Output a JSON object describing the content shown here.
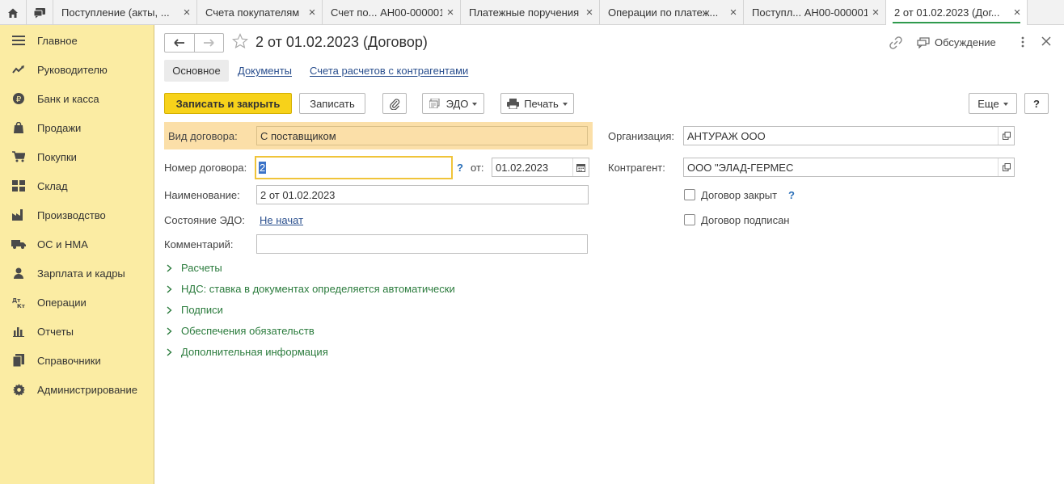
{
  "tabbar": {
    "tabs": [
      {
        "label": "Поступление (акты, ..."
      },
      {
        "label": "Счета покупателям"
      },
      {
        "label": "Счет по... АН00-000001"
      },
      {
        "label": "Платежные поручения"
      },
      {
        "label": "Операции по платеж..."
      },
      {
        "label": "Поступл... АН00-000001"
      },
      {
        "label": "2 от 01.02.2023 (Дог..."
      }
    ]
  },
  "sidebar": {
    "items": [
      {
        "label": "Главное",
        "icon": "menu-icon"
      },
      {
        "label": "Руководителю",
        "icon": "trend-icon"
      },
      {
        "label": "Банк и касса",
        "icon": "ruble-icon"
      },
      {
        "label": "Продажи",
        "icon": "bag-icon"
      },
      {
        "label": "Покупки",
        "icon": "cart-icon"
      },
      {
        "label": "Склад",
        "icon": "warehouse-icon"
      },
      {
        "label": "Производство",
        "icon": "factory-icon"
      },
      {
        "label": "ОС и НМА",
        "icon": "truck-icon"
      },
      {
        "label": "Зарплата и кадры",
        "icon": "person-icon"
      },
      {
        "label": "Операции",
        "icon": "dt-kt-icon"
      },
      {
        "label": "Отчеты",
        "icon": "bar-chart-icon"
      },
      {
        "label": "Справочники",
        "icon": "books-icon"
      },
      {
        "label": "Администрирование",
        "icon": "gear-icon"
      }
    ]
  },
  "header": {
    "title": "2 от 01.02.2023 (Договор)",
    "discussion_label": "Обсуждение"
  },
  "form_tabs": {
    "main": "Основное",
    "documents": "Документы",
    "accounts": "Счета расчетов с контрагентами"
  },
  "toolbar": {
    "save_close": "Записать и закрыть",
    "save": "Записать",
    "edo": "ЭДО",
    "print": "Печать",
    "more": "Еще",
    "help": "?"
  },
  "form": {
    "contract_type_label": "Вид договора:",
    "contract_type_value": "С поставщиком",
    "number_label": "Номер договора:",
    "number_value": "2",
    "date_label": "от:",
    "date_value": "01.02.2023",
    "name_label": "Наименование:",
    "name_value": "2 от 01.02.2023",
    "edo_state_label": "Состояние ЭДО:",
    "edo_state_value": "Не начат",
    "comment_label": "Комментарий:",
    "comment_value": "",
    "organization_label": "Организация:",
    "organization_value": "АНТУРАЖ ООО",
    "counterparty_label": "Контрагент:",
    "counterparty_value": "ООО \"ЭЛАД-ГЕРМЕС",
    "closed_label": "Договор закрыт",
    "signed_label": "Договор подписан",
    "help_mark": "?"
  },
  "groups": [
    "Расчеты",
    "НДС: ставка в документах определяется автоматически",
    "Подписи",
    "Обеспечения обязательств",
    "Дополнительная информация"
  ],
  "colors": {
    "sidebar_bg": "#fbeca3",
    "primary_button": "#f7d21a",
    "highlight_row": "#fbdfa8",
    "group_link": "#2a7b3c",
    "active_tab_underline": "#2f9a4d"
  }
}
